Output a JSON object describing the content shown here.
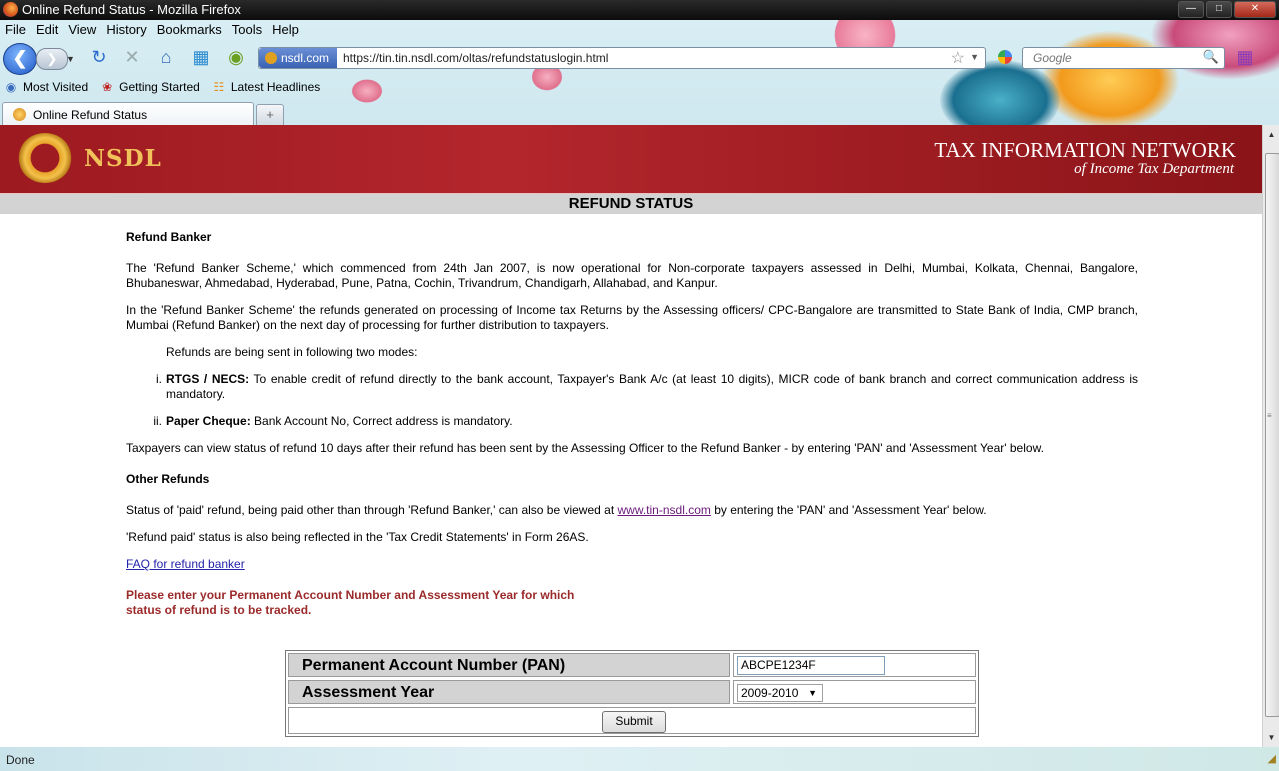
{
  "window": {
    "title": "Online Refund Status - Mozilla Firefox"
  },
  "menu": [
    "File",
    "Edit",
    "View",
    "History",
    "Bookmarks",
    "Tools",
    "Help"
  ],
  "nav": {
    "site_identity": "nsdl.com",
    "url": "https://tin.tin.nsdl.com/oltas/refundstatuslogin.html",
    "search_placeholder": "Google"
  },
  "bookmarks": [
    "Most Visited",
    "Getting Started",
    "Latest Headlines"
  ],
  "tabs": [
    {
      "label": "Online Refund Status"
    }
  ],
  "banner": {
    "brand": "NSDL",
    "title": "TAX INFORMATION NETWORK",
    "subtitle": "of Income Tax Department"
  },
  "page": {
    "heading": "REFUND STATUS",
    "section1_title": "Refund Banker",
    "para1": "The 'Refund Banker Scheme,' which commenced from 24th Jan 2007, is now operational for Non-corporate taxpayers assessed in Delhi, Mumbai, Kolkata, Chennai, Bangalore, Bhubaneswar, Ahmedabad, Hyderabad, Pune, Patna, Cochin, Trivandrum, Chandigarh, Allahabad, and Kanpur.",
    "para2": "In the 'Refund Banker Scheme' the refunds generated on processing of Income tax Returns by the Assessing officers/ CPC-Bangalore are transmitted to State Bank of India, CMP branch, Mumbai (Refund Banker) on the next day of processing for further distribution to taxpayers.",
    "modes_intro": "Refunds are being sent in following two modes:",
    "modes": [
      {
        "num": "i.",
        "title": "RTGS / NECS:",
        "text": " To enable credit of refund directly to the bank account, Taxpayer's Bank A/c (at least 10 digits), MICR code of bank branch and correct communication address is mandatory."
      },
      {
        "num": "ii.",
        "title": "Paper Cheque:",
        "text": " Bank Account No, Correct address is mandatory."
      }
    ],
    "para3": "Taxpayers can view status of refund 10 days after their refund has been sent by the Assessing Officer to the Refund Banker - by entering 'PAN' and 'Assessment Year' below.",
    "section2_title": "Other Refunds",
    "para4_pre": "Status of 'paid' refund, being paid other than through 'Refund Banker,' can also be viewed at ",
    "para4_link": "www.tin-nsdl.com",
    "para4_post": " by entering the 'PAN' and 'Assessment Year' below.",
    "para5": "'Refund paid' status is also being reflected in the 'Tax Credit Statements' in Form 26AS.",
    "faq_link": "FAQ for refund banker",
    "instruction_line1": "Please enter your Permanent Account Number and Assessment Year for which",
    "instruction_line2": "status of refund is to be tracked."
  },
  "form": {
    "pan_label": "Permanent Account Number (PAN)",
    "pan_value": "ABCPE1234F",
    "ay_label": "Assessment Year",
    "ay_selected": "2009-2010",
    "submit_label": "Submit"
  },
  "status": {
    "text": "Done"
  }
}
